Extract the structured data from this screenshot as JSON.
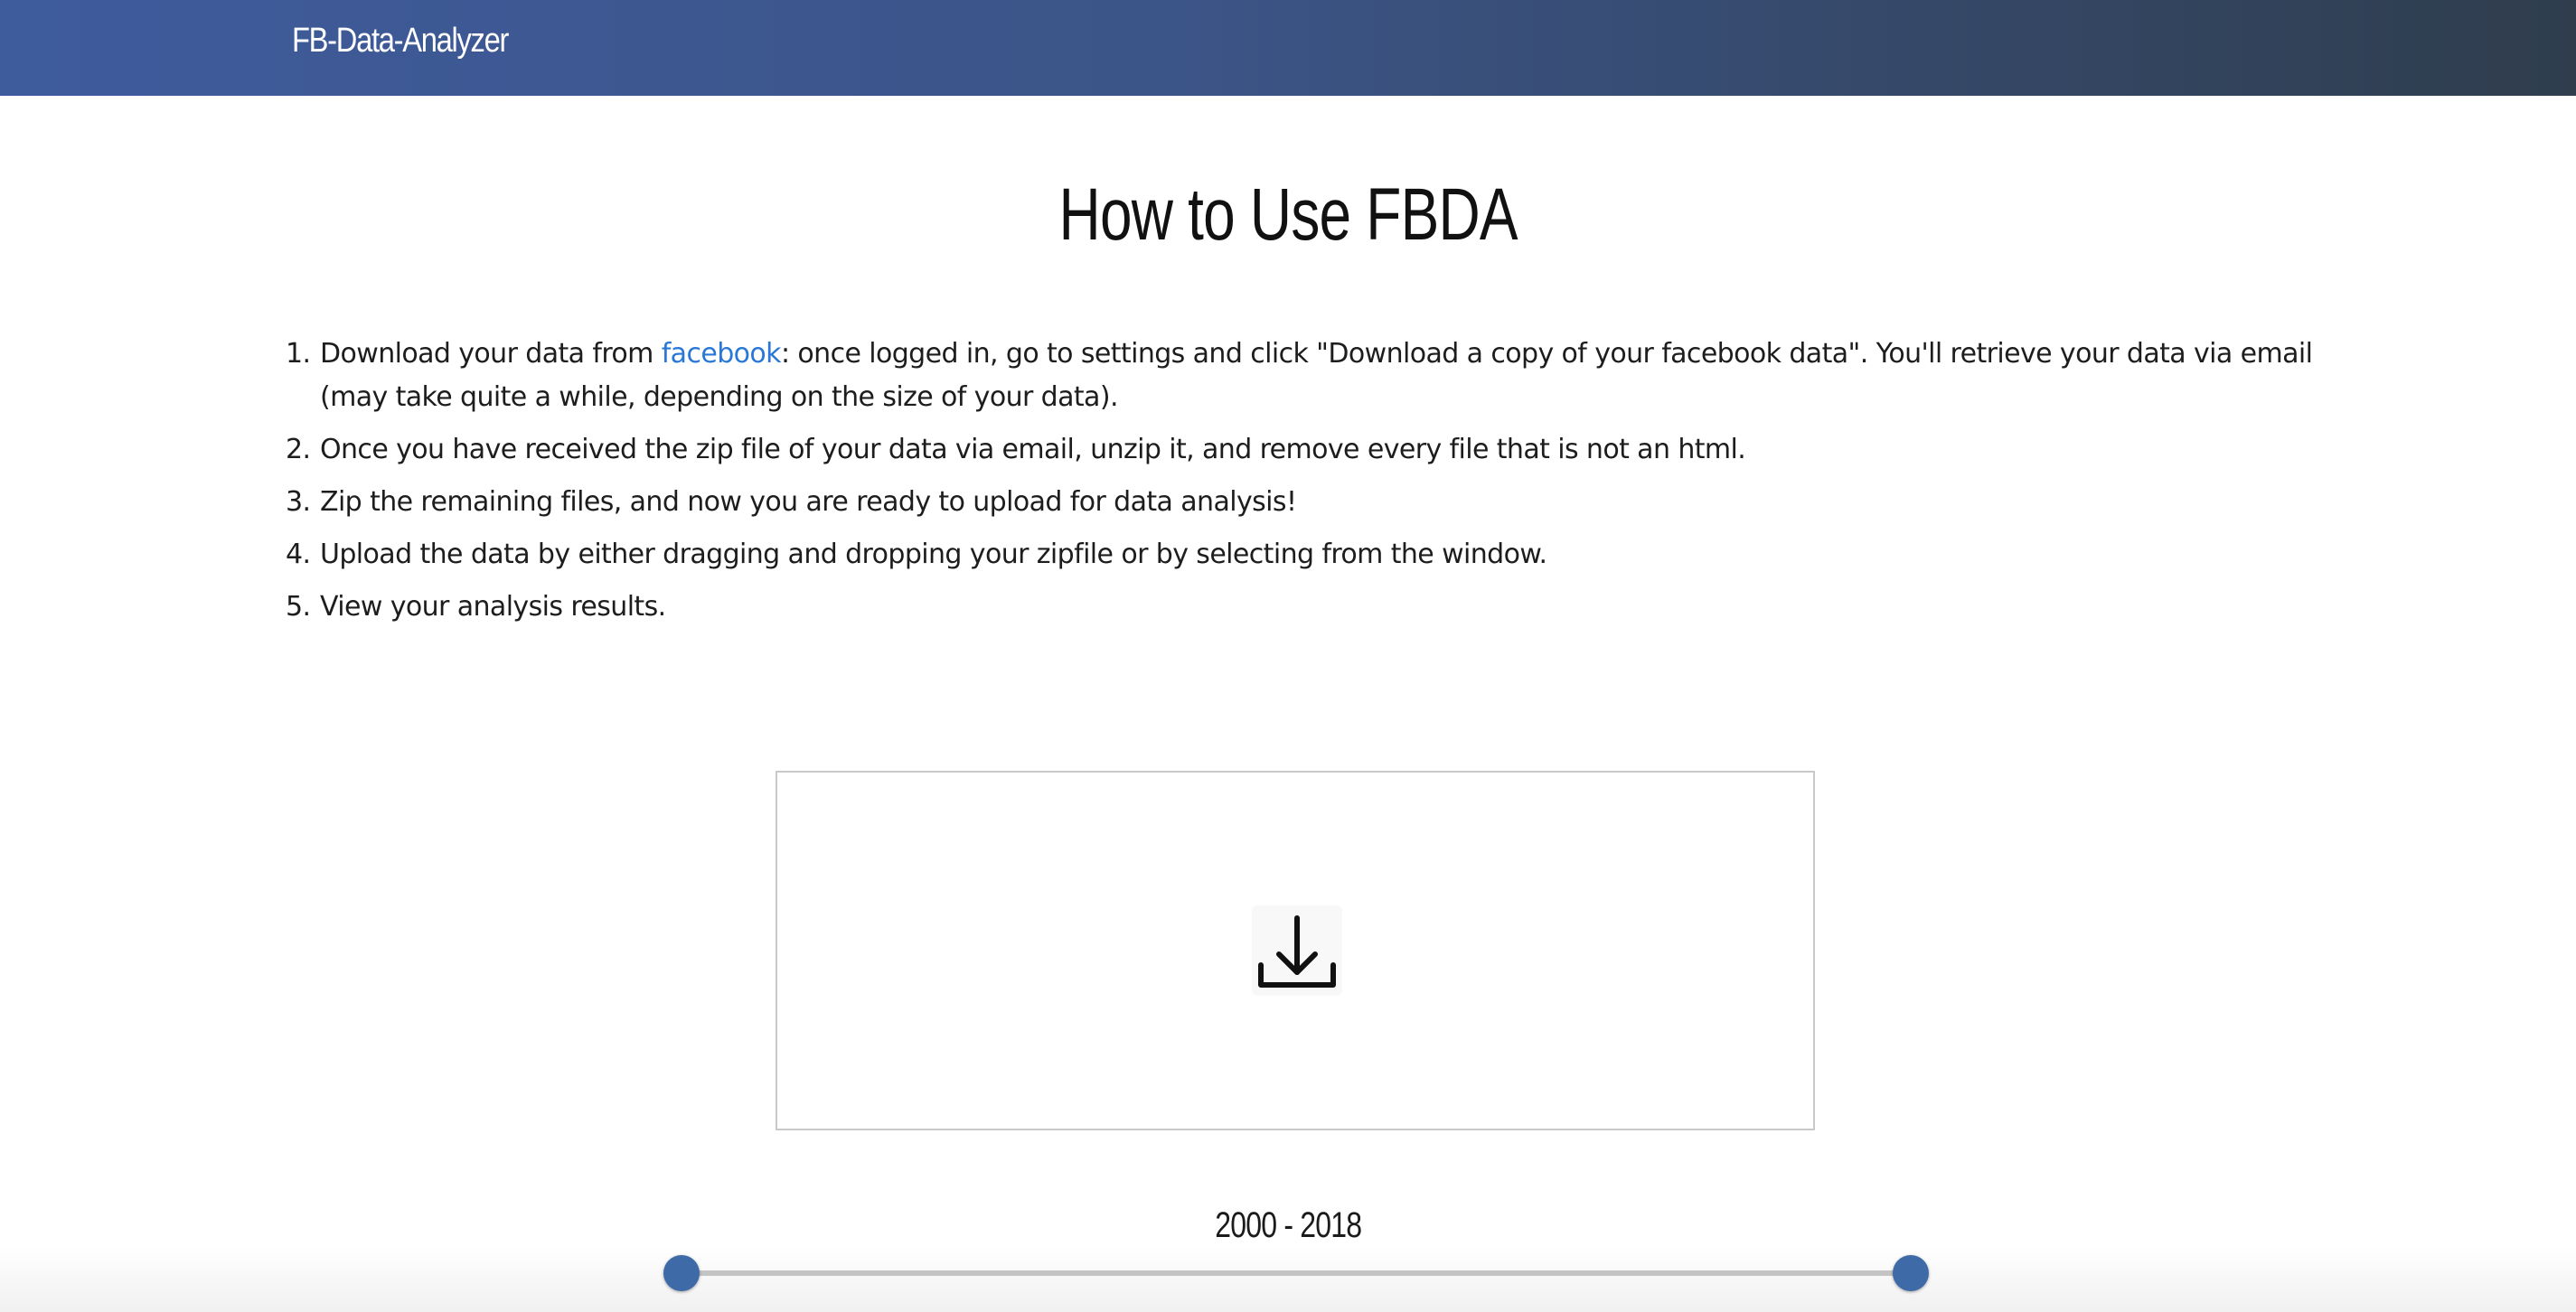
{
  "navbar": {
    "brand": "FB-Data-Analyzer",
    "gradient_start": "#3e5b9c",
    "gradient_end": "#2f3d4d"
  },
  "main": {
    "title": "How to Use FBDA",
    "steps": [
      {
        "number": "1.",
        "text_before_link": "Download your data from ",
        "link_text": "facebook",
        "text_after_link": ": once logged in, go to settings and click \"Download a copy of your facebook data\". You'll retrieve your data via email (may take quite a while, depending on the size of your data)."
      },
      {
        "number": "2.",
        "text": "Once you have received the zip file of your data via email, unzip it, and remove every file that is not an html."
      },
      {
        "number": "3.",
        "text": "Zip the remaining files, and now you are ready to upload for data analysis!"
      },
      {
        "number": "4.",
        "text": "Upload the data by either dragging and dropping your zipfile or by selecting from the window."
      },
      {
        "number": "5.",
        "text": "View your analysis results."
      }
    ],
    "link_color": "#2a78d6"
  },
  "dropzone": {
    "icon": "download-icon"
  },
  "year_range": {
    "label": "2000 - 2018",
    "min": 2000,
    "max": 2018,
    "selected_start": 2000,
    "selected_end": 2018,
    "handle_color": "#3f6aa8"
  }
}
